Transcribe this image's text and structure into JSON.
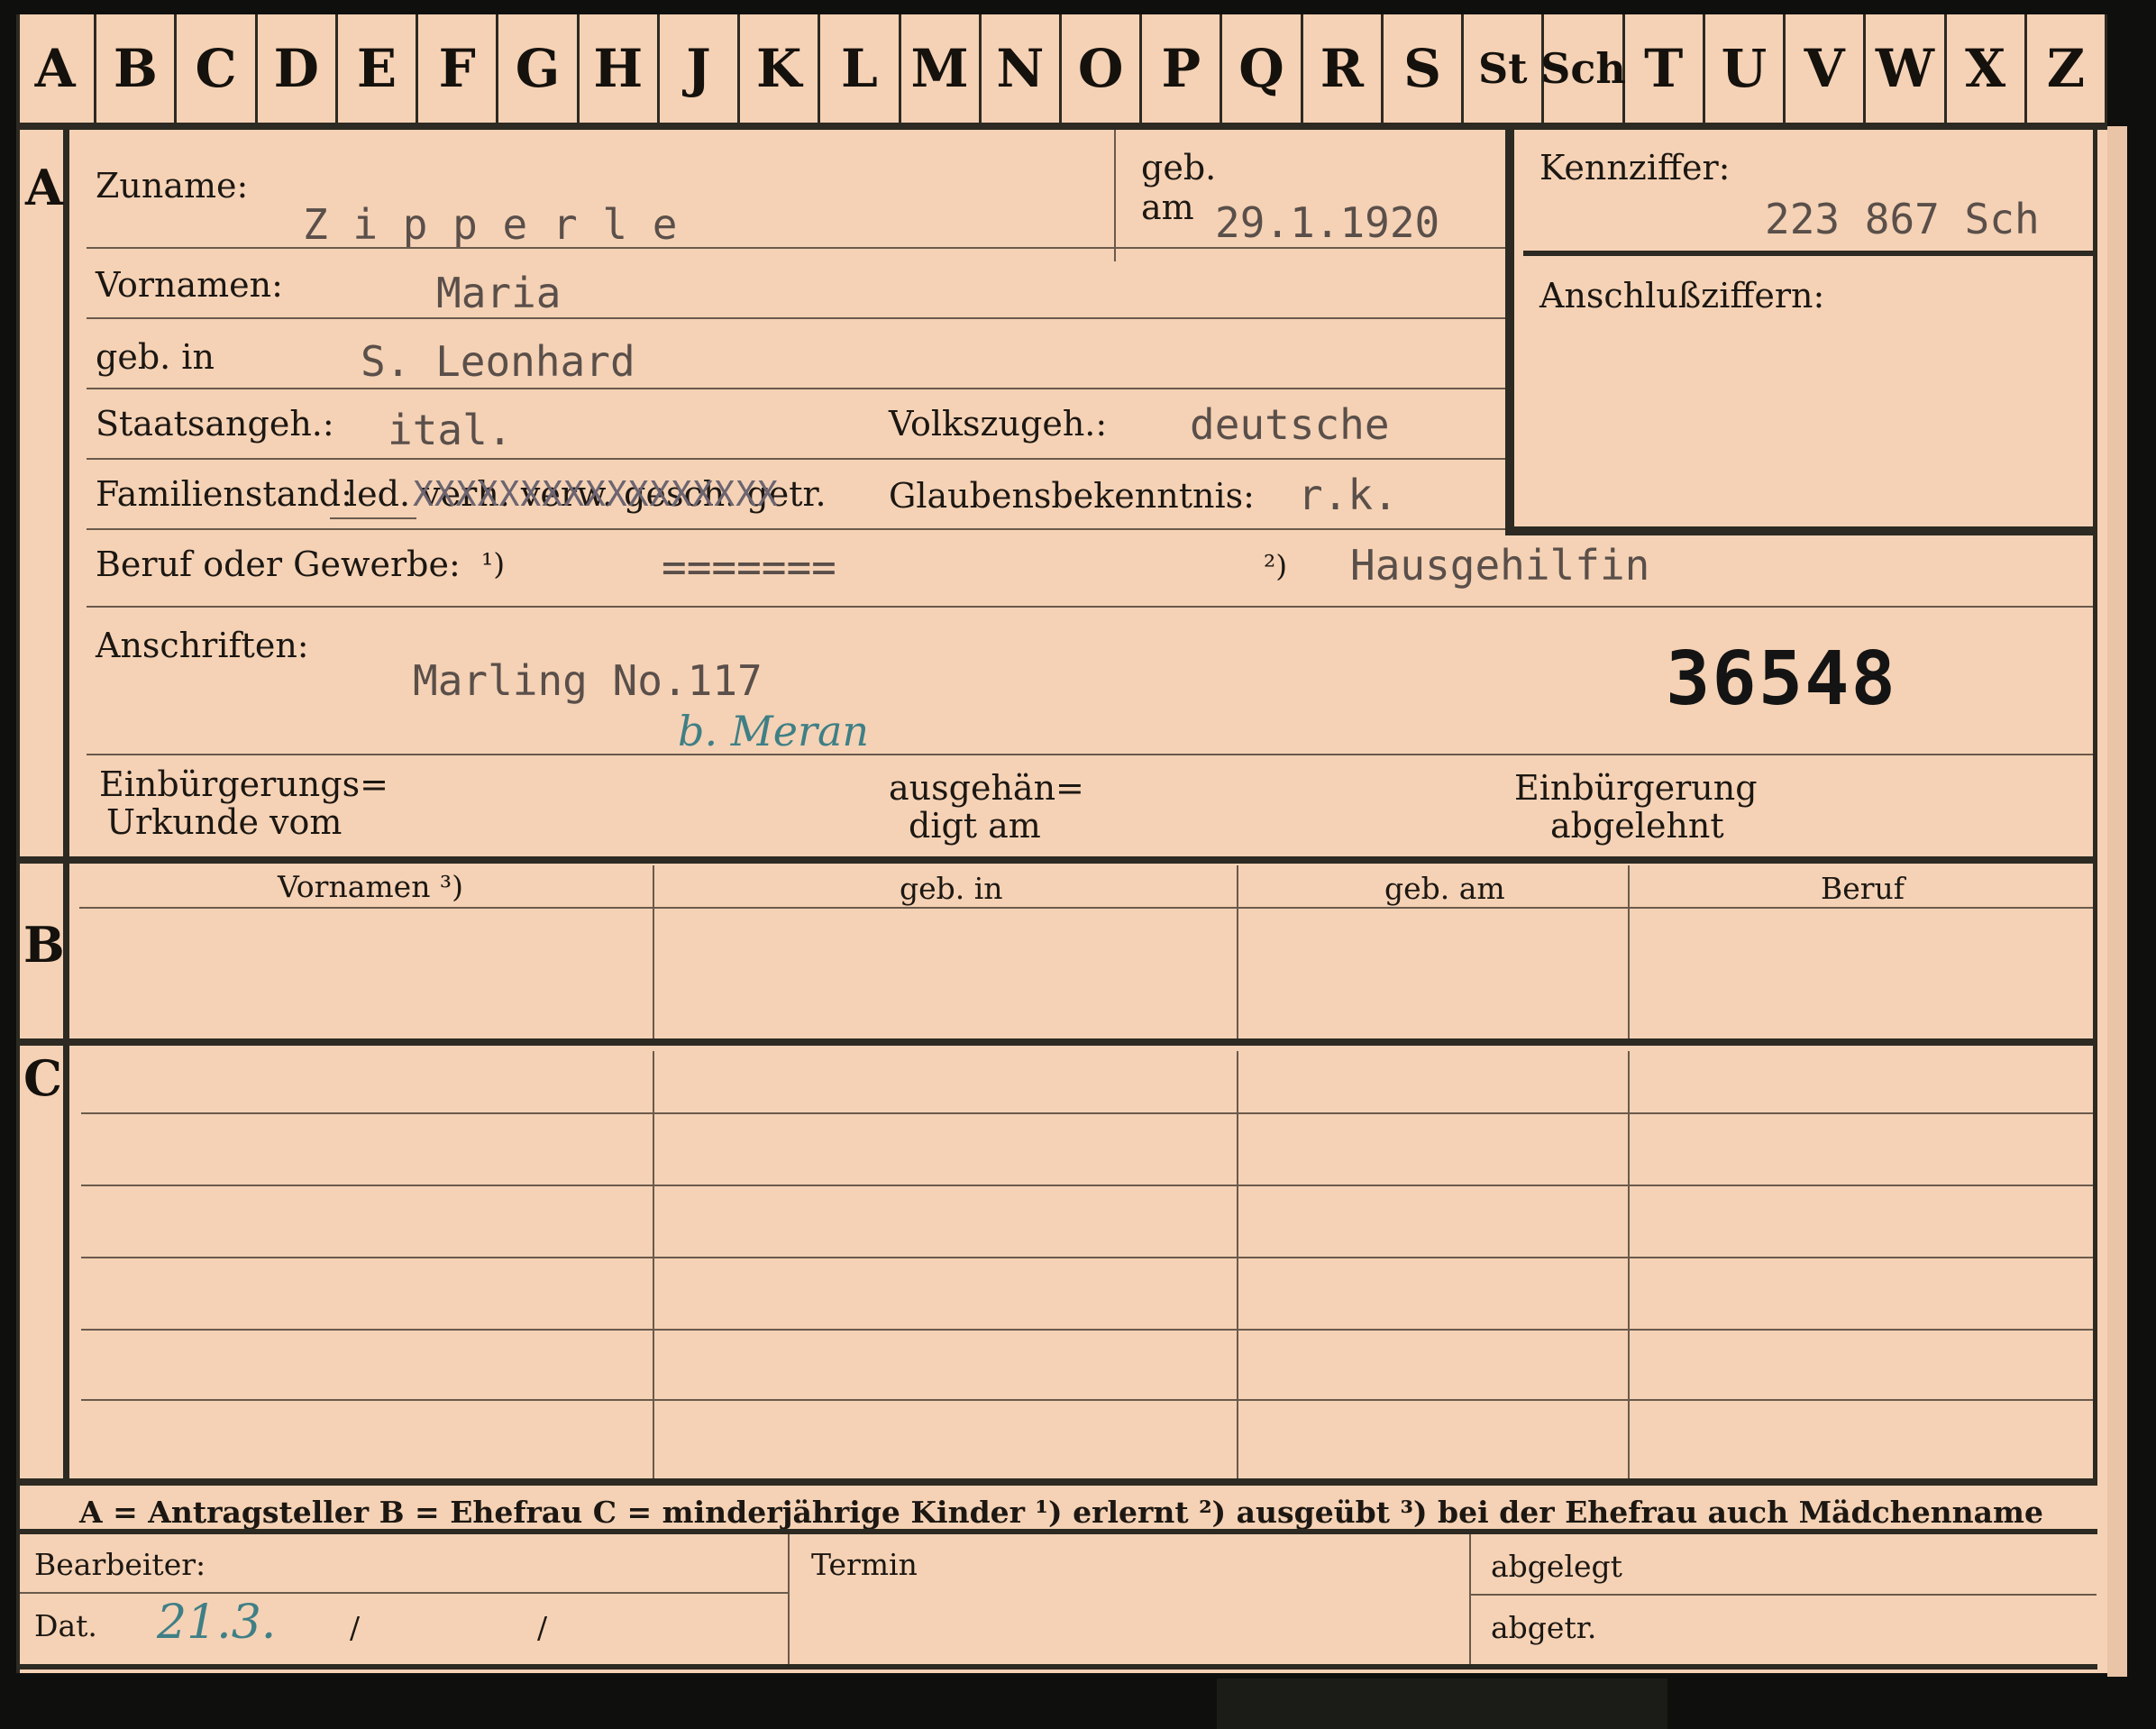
{
  "tabs": [
    "A",
    "B",
    "C",
    "D",
    "E",
    "F",
    "G",
    "H",
    "J",
    "K",
    "L",
    "M",
    "N",
    "O",
    "P",
    "Q",
    "R",
    "S",
    "St",
    "Sch",
    "T",
    "U",
    "V",
    "W",
    "X",
    "Z"
  ],
  "sections": {
    "a": "A",
    "b": "B",
    "c": "C"
  },
  "labels": {
    "zuname": "Zuname:",
    "geb": "geb.",
    "am": "am",
    "kennziffer": "Kennziffer:",
    "vornamen": "Vornamen:",
    "anschlussziffern": "Anschlußziffern:",
    "geb_in": "geb. in",
    "staatsangeh": "Staatsangeh.:",
    "volkszugeh": "Volkszugeh.:",
    "familienstand": "Familienstand:",
    "familienstand_options": "led. verh. verw. gesch. getr.",
    "glaubensbekenntnis": "Glaubensbekenntnis:",
    "beruf": "Beruf oder Gewerbe:",
    "fn1": "¹)",
    "fn2": "²)",
    "anschriften": "Anschriften:",
    "einbuergerungs_1": "Einbürgerungs=",
    "einbuergerungs_2": "Urkunde vom",
    "ausgehaen_1": "ausgehän=",
    "ausgehaen_2": "digt am",
    "einbuergerung_1": "Einbürgerung",
    "einbuergerung_2": "abgelehnt"
  },
  "values": {
    "zuname": "Z i p p e r l e",
    "geb_am": "29.1.1920",
    "kennziffer": "223 867  Sch",
    "vornamen": "Maria",
    "geb_in": "S. Leonhard",
    "staatsangeh": "ital.",
    "volkszugeh": "deutsche",
    "familienstand_cross": "XXXXXXXXXXXXXXXXX",
    "glaubensbekenntnis": "r.k.",
    "beruf_1": "=======",
    "beruf_2": "Hausgehilfin",
    "anschrift": "Marling No.117",
    "anschrift_hand": "b. Meran",
    "stamp_number": "36548"
  },
  "table": {
    "headers": [
      "Vornamen ³)",
      "geb. in",
      "geb. am",
      "Beruf"
    ]
  },
  "legend": "A = Antragsteller   B = Ehefrau   C = minderjährige Kinder   ¹) erlernt   ²) ausgeübt   ³) bei der Ehefrau auch Mädchenname",
  "footer": {
    "bearbeiter": "Bearbeiter:",
    "dat": "Dat.",
    "dat_hand": "21.3.",
    "slash1": "/",
    "slash2": "/",
    "termin": "Termin",
    "abgelegt": "abgelegt",
    "abgetr": "abgetr."
  }
}
